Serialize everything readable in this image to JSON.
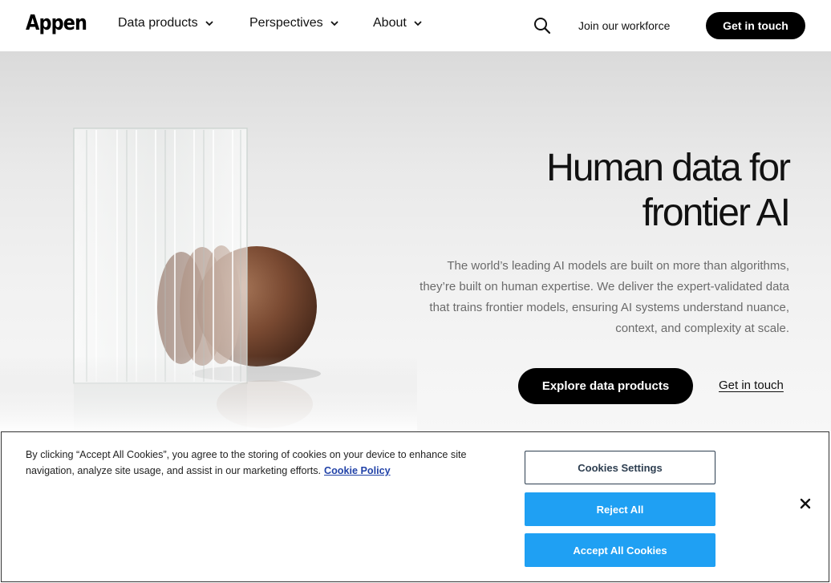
{
  "nav": {
    "logo": "Appen",
    "items": [
      {
        "label": "Data products"
      },
      {
        "label": "Perspectives"
      },
      {
        "label": "About"
      }
    ],
    "join_label": "Join our workforce",
    "cta_label": "Get in touch"
  },
  "hero": {
    "title_line1": "Human data for",
    "title_line2": "frontier AI",
    "body": "The world’s leading AI models are built on more than algorithms, they’re built on human expertise. We deliver the expert-validated data that trains frontier models, ensuring AI systems understand nuance, context, and complexity at scale.",
    "primary_label": "Explore data products",
    "secondary_label": "Get in touch"
  },
  "cookie": {
    "text": "By clicking “Accept All Cookies”, you agree to the storing of cookies on your device to enhance site navigation, analyze site usage, and assist in our marketing efforts.",
    "policy_label": "Cookie Policy",
    "settings_label": "Cookies Settings",
    "reject_label": "Reject All",
    "accept_label": "Accept All Cookies"
  },
  "colors": {
    "primary": "#000000",
    "cookie_accent": "#1fa0f3",
    "cookie_link": "#2243a8"
  }
}
